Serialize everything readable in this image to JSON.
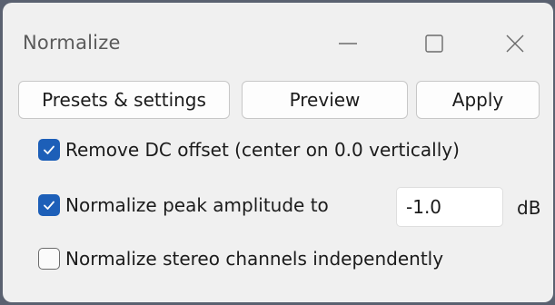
{
  "window": {
    "title": "Normalize",
    "controls": {
      "minimize_icon": "minimize-icon",
      "maximize_icon": "maximize-icon",
      "close_icon": "close-icon"
    }
  },
  "buttons": {
    "presets_label": "Presets & settings",
    "preview_label": "Preview",
    "apply_label": "Apply"
  },
  "options": {
    "remove_dc": {
      "label": "Remove DC offset (center on 0.0 vertically)",
      "checked": true
    },
    "normalize_peak": {
      "label": "Normalize peak amplitude to",
      "checked": true,
      "value": "-1.0",
      "unit": "dB"
    },
    "stereo_independent": {
      "label": "Normalize stereo channels independently",
      "checked": false
    }
  },
  "colors": {
    "accent": "#1d5fb8",
    "dialog_background": "#f0f0f0",
    "desktop_background": "#5a6170"
  }
}
